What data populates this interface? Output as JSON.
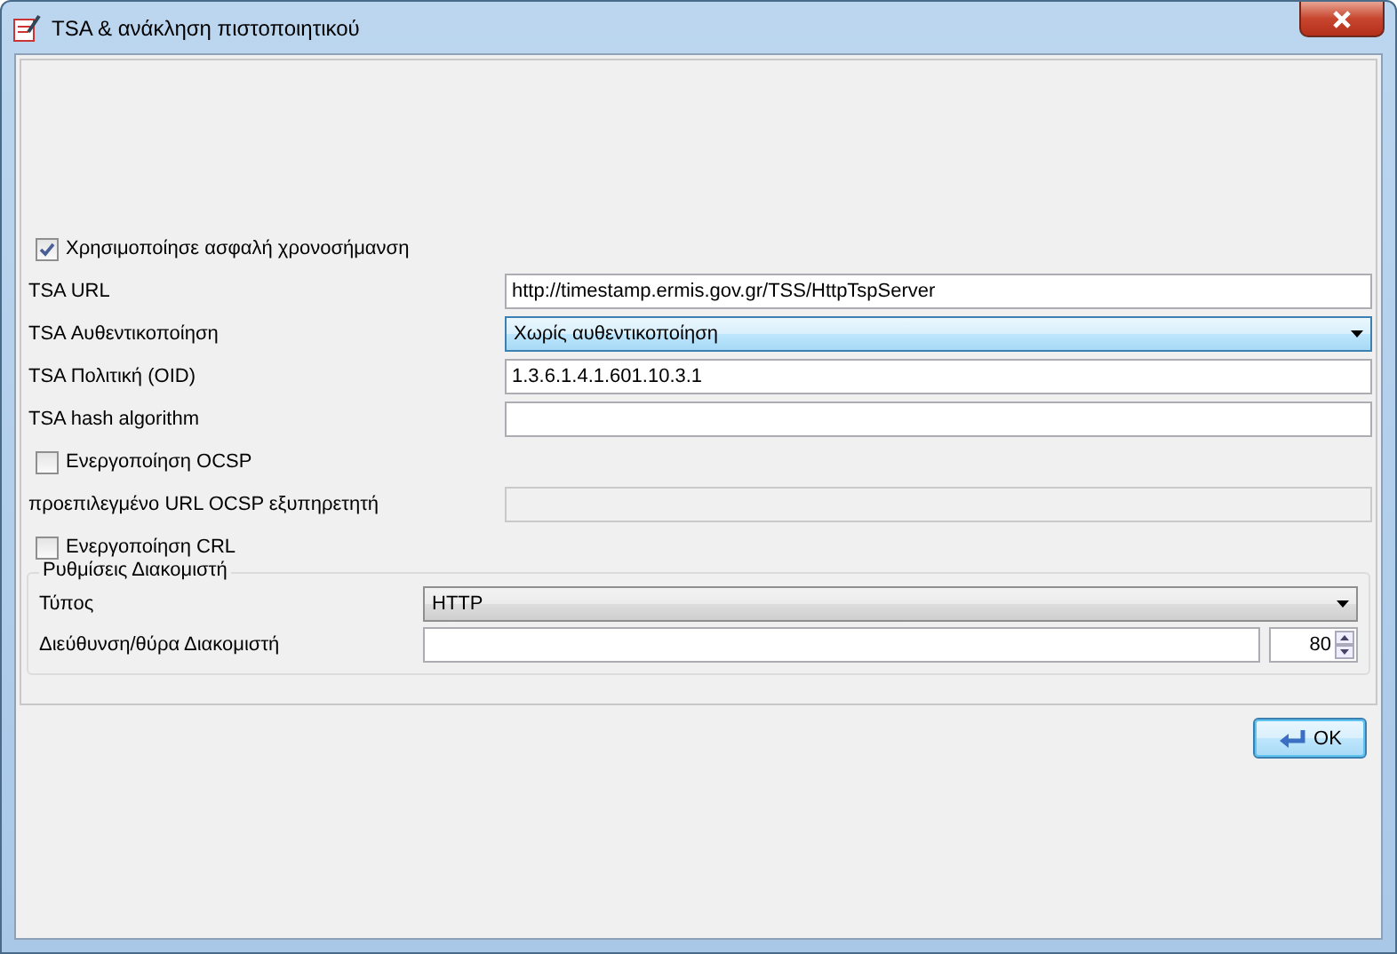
{
  "window": {
    "title": "TSA & ανάκληση πιστοποιητικού"
  },
  "tsa": {
    "use_timestamp": {
      "label": "Χρησιμοποίησε ασφαλή χρονοσήμανση",
      "checked": true
    },
    "fields": [
      {
        "kind": "text",
        "label": "TSA URL",
        "value": "http://timestamp.ermis.gov.gr/TSS/HttpTspServer"
      },
      {
        "kind": "dropdown",
        "label": "TSA Αυθεντικοποίηση",
        "value": "Χωρίς αυθεντικοποίηση"
      },
      {
        "kind": "text",
        "label": "TSA Πολιτική (OID)",
        "value": "1.3.6.1.4.1.601.10.3.1"
      },
      {
        "kind": "text",
        "label": "TSA hash algorithm"
      }
    ]
  },
  "ocsp": {
    "enable": {
      "label": "Ενεργοποίηση OCSP",
      "checked": false
    },
    "default_url": {
      "label": "προεπιλεγμένο URL OCSP εξυπηρετητή",
      "disabled": true
    }
  },
  "crl": {
    "enable": {
      "label": "Ενεργοποίηση CRL",
      "checked": false
    }
  },
  "server": {
    "title": "Ρυθμίσεις Διακομιστή",
    "type": {
      "label": "Τύπος",
      "value": "HTTP"
    },
    "address": {
      "label": "Διεύθυνση/θύρα Διακομιστή",
      "port": "80"
    }
  },
  "buttons": [
    {
      "label": "OK",
      "default": true
    }
  ]
}
